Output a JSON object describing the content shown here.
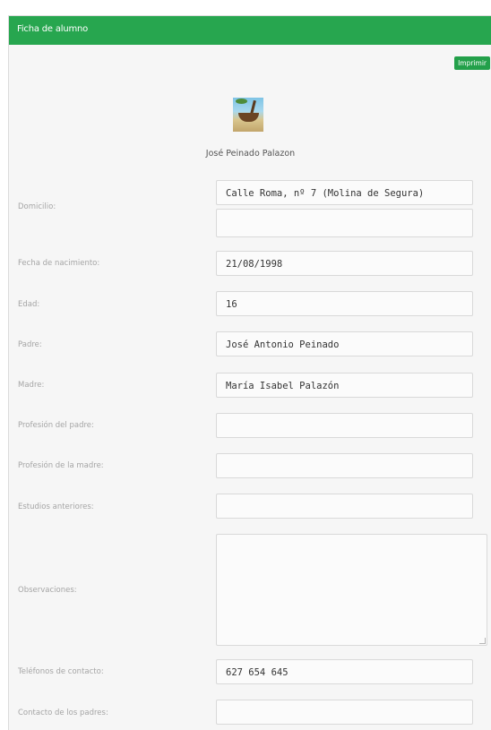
{
  "header": {
    "title": "Ficha de alumno"
  },
  "actions": {
    "print_label": "Imprimir"
  },
  "student": {
    "name": "José Peinado Palazon"
  },
  "form": {
    "domicilio_label": "Domicilio:",
    "domicilio_line1": "Calle Roma, nº 7 (Molina de Segura)",
    "domicilio_line2": "",
    "fecha_label": "Fecha de nacimiento:",
    "fecha_value": "21/08/1998",
    "edad_label": "Edad:",
    "edad_value": "16",
    "padre_label": "Padre:",
    "padre_value": "José Antonio Peinado",
    "madre_label": "Madre:",
    "madre_value": "María Isabel Palazón",
    "prof_padre_label": "Profesión del padre:",
    "prof_padre_value": "",
    "prof_madre_label": "Profesión de la madre:",
    "prof_madre_value": "",
    "estudios_label": "Estudios anteriores:",
    "estudios_value": "",
    "observaciones_label": "Observaciones:",
    "observaciones_value": "",
    "telefonos_label": "Teléfonos de contacto:",
    "telefonos_value": "627 654 645",
    "contacto_padres_label": "Contacto de los padres:",
    "contacto_padres_value": ""
  }
}
